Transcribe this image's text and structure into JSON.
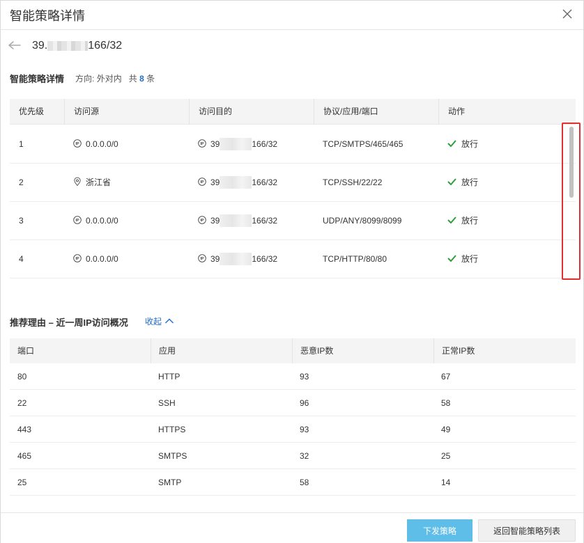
{
  "dialog": {
    "title": "智能策略详情",
    "close_icon": "close-icon"
  },
  "header": {
    "back_icon": "arrow-left-icon",
    "ip_prefix": "39.",
    "ip_suffix": "166/32"
  },
  "policy": {
    "section_title": "智能策略详情",
    "direction_label": "方向:",
    "direction_value": "外对内",
    "count_prefix": "共",
    "count_value": "8",
    "count_suffix": "条",
    "columns": [
      "优先级",
      "访问源",
      "访问目的",
      "协议/应用/端口",
      "动作"
    ],
    "rows": [
      {
        "priority": "1",
        "source_icon": "ip-icon",
        "source": "0.0.0.0/0",
        "dest_prefix": "39",
        "dest_suffix": "166/32",
        "protocol": "TCP/SMTPS/465/465",
        "action": "放行"
      },
      {
        "priority": "2",
        "source_icon": "location-icon",
        "source": "浙江省",
        "dest_prefix": "39",
        "dest_suffix": "166/32",
        "protocol": "TCP/SSH/22/22",
        "action": "放行"
      },
      {
        "priority": "3",
        "source_icon": "ip-icon",
        "source": "0.0.0.0/0",
        "dest_prefix": "39",
        "dest_suffix": "166/32",
        "protocol": "UDP/ANY/8099/8099",
        "action": "放行"
      },
      {
        "priority": "4",
        "source_icon": "ip-icon",
        "source": "0.0.0.0/0",
        "dest_prefix": "39",
        "dest_suffix": "166/32",
        "protocol": "TCP/HTTP/80/80",
        "action": "放行"
      }
    ]
  },
  "reason": {
    "section_title": "推荐理由 – 近一周IP访问概况",
    "collapse_label": "收起",
    "columns": [
      "端口",
      "应用",
      "恶意IP数",
      "正常IP数"
    ],
    "rows": [
      {
        "port": "80",
        "app": "HTTP",
        "malicious": "93",
        "normal": "67"
      },
      {
        "port": "22",
        "app": "SSH",
        "malicious": "96",
        "normal": "58"
      },
      {
        "port": "443",
        "app": "HTTPS",
        "malicious": "93",
        "normal": "49"
      },
      {
        "port": "465",
        "app": "SMTPS",
        "malicious": "32",
        "normal": "25"
      },
      {
        "port": "25",
        "app": "SMTP",
        "malicious": "58",
        "normal": "14"
      }
    ]
  },
  "footer": {
    "deploy_label": "下发策略",
    "back_label": "返回智能策略列表"
  },
  "colors": {
    "primary_button": "#5fbee8",
    "link": "#1f6bd0",
    "check": "#2e9e3e",
    "highlight_border": "#e03030"
  }
}
